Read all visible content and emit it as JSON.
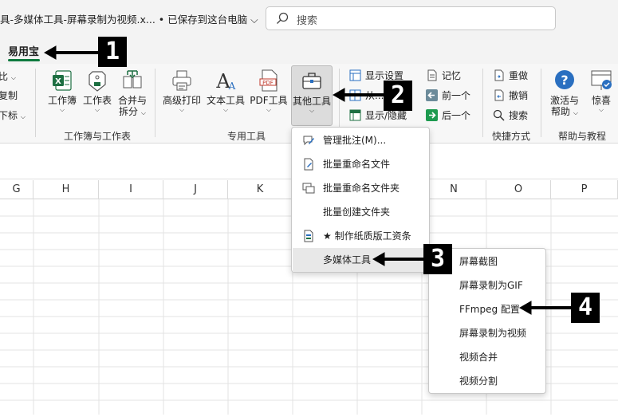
{
  "titlebar": {
    "title": "具-多媒体工具-屏幕录制为视频.x... • 已保存到这台电脑 ⌵",
    "search_placeholder": "搜索"
  },
  "tabs": {
    "active": "易用宝"
  },
  "ribbon": {
    "left_partial": [
      "比",
      "复制",
      "下标"
    ],
    "group1": {
      "label": "工作簿与工作表",
      "buttons": [
        {
          "label": "工作簿",
          "icon": "excel-icon"
        },
        {
          "label": "工作表",
          "icon": "sheet-tag-icon"
        },
        {
          "label": "合并与",
          "label2": "拆分",
          "icon": "merge-icon"
        }
      ]
    },
    "group2": {
      "label": "专用工具",
      "buttons": [
        {
          "label": "高级打印",
          "icon": "printer-icon"
        },
        {
          "label": "文本工具",
          "icon": "text-a-icon"
        },
        {
          "label": "PDF工具",
          "icon": "pdf-icon"
        },
        {
          "label": "其他工具",
          "icon": "toolbox-icon"
        }
      ]
    },
    "group3": {
      "items": [
        "显示设置",
        "从...",
        "显示/隐藏"
      ],
      "items2": [
        "记忆",
        "前一个",
        "后一个"
      ]
    },
    "group4": {
      "label": "快捷方式",
      "items": [
        "重做",
        "撤销",
        "搜索"
      ]
    },
    "group5": {
      "label": "帮助与教程",
      "buttons": [
        {
          "label": "激活与",
          "label2": "帮助",
          "icon": "help-icon"
        },
        {
          "label": "惊喜",
          "icon": "gift-icon"
        }
      ]
    }
  },
  "columns": [
    "G",
    "H",
    "I",
    "J",
    "K",
    "N",
    "O",
    "P"
  ],
  "other_tools_menu": {
    "items": [
      {
        "label": "管理批注(M)...",
        "icon": "comment-edit-icon"
      },
      {
        "label": "批量重命名文件",
        "icon": "file-rename-icon"
      },
      {
        "label": "批量重命名文件夹",
        "icon": "folder-rename-icon"
      },
      {
        "label": "批量创建文件夹",
        "icon": ""
      },
      {
        "label": "★ 制作纸质版工资条",
        "icon": "payroll-icon"
      },
      {
        "label": "多媒体工具",
        "icon": "",
        "submenu": true
      }
    ]
  },
  "multimedia_submenu": {
    "items": [
      "屏幕截图",
      "屏幕录制为GIF",
      "FFmpeg 配置",
      "屏幕录制为视频",
      "视频合并",
      "视频分割"
    ]
  },
  "callouts": [
    "1",
    "2",
    "3",
    "4"
  ],
  "colors": {
    "accent": "#0e7a3e",
    "callout_bg": "#000000"
  }
}
